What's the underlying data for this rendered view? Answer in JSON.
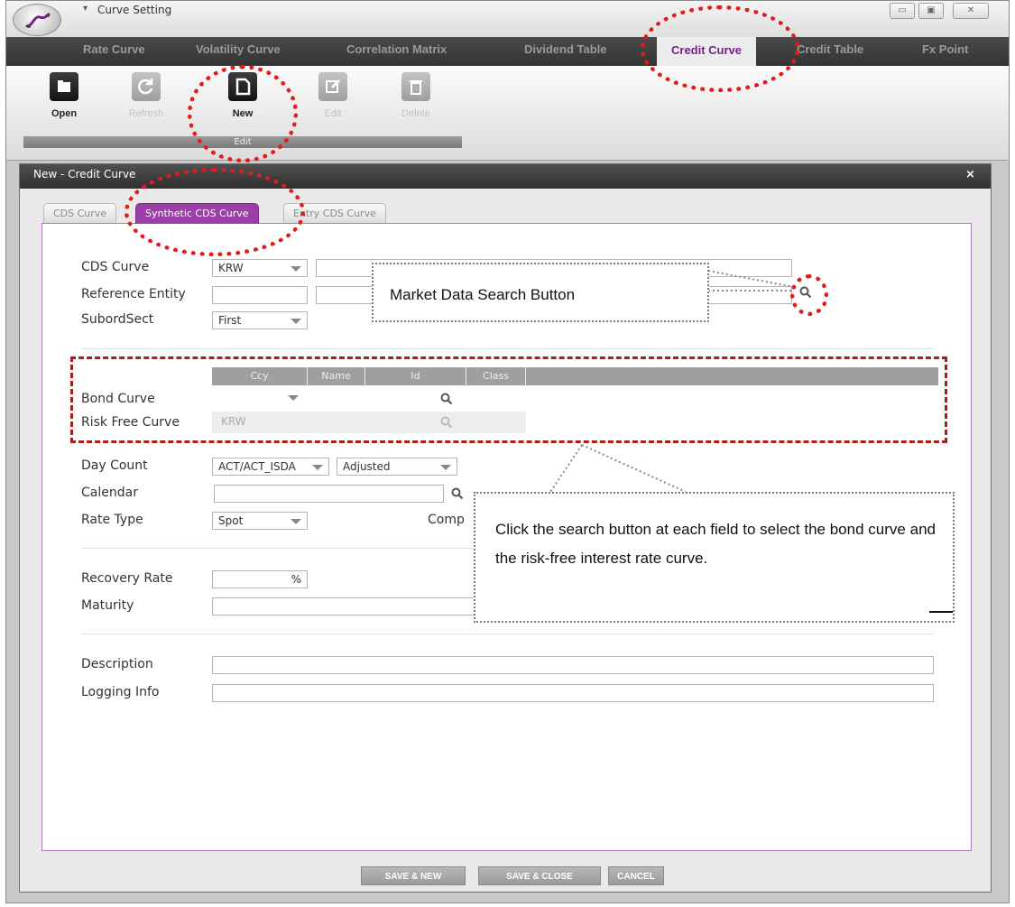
{
  "window": {
    "title": "Curve Setting",
    "controls": {
      "minimize": "▭",
      "maximize": "▣",
      "close": "✕"
    }
  },
  "ribbon_tabs": [
    {
      "label": "Rate Curve"
    },
    {
      "label": "Volatility Curve"
    },
    {
      "label": "Correlation Matrix"
    },
    {
      "label": "Dividend Table"
    },
    {
      "label": "Credit Curve"
    },
    {
      "label": "Credit Table"
    },
    {
      "label": "Fx Point"
    }
  ],
  "ribbon_buttons": [
    {
      "label": "Open",
      "icon": "folder-icon",
      "enabled": true
    },
    {
      "label": "Refresh",
      "icon": "refresh-icon",
      "enabled": false
    },
    {
      "label": "New",
      "icon": "new-document-icon",
      "enabled": true
    },
    {
      "label": "Edit",
      "icon": "edit-icon",
      "enabled": false
    },
    {
      "label": "Delete",
      "icon": "trash-icon",
      "enabled": false
    }
  ],
  "ribbon_group_label": "Edit",
  "dialog": {
    "title": "New - Credit Curve",
    "close": "×",
    "tabs": [
      {
        "label": "CDS Curve",
        "active": false
      },
      {
        "label": "Synthetic CDS Curve",
        "active": true
      },
      {
        "label": "Entry CDS Curve",
        "active": false
      }
    ]
  },
  "form": {
    "cds_curve_label": "CDS Curve",
    "cds_curve_ccy": "KRW",
    "reference_entity_label": "Reference Entity",
    "subordsect_label": "SubordSect",
    "subordsect_value": "First",
    "curve_table_headers": [
      "Ccy",
      "Name",
      "Id",
      "Class"
    ],
    "bond_curve_label": "Bond Curve",
    "risk_free_curve_label": "Risk Free Curve",
    "risk_free_ccy": "KRW",
    "day_count_label": "Day Count",
    "day_count_value": "ACT/ACT_ISDA",
    "day_count_adjust": "Adjusted",
    "calendar_label": "Calendar",
    "rate_type_label": "Rate Type",
    "rate_type_value": "Spot",
    "compounding_label_partial": "Comp",
    "recovery_rate_label": "Recovery Rate",
    "recovery_rate_unit": "%",
    "maturity_label": "Maturity",
    "description_label": "Description",
    "logging_info_label": "Logging Info"
  },
  "footer_buttons": [
    {
      "label": "SAVE & NEW"
    },
    {
      "label": "SAVE & CLOSE"
    },
    {
      "label": "CANCEL"
    }
  ],
  "annotations": {
    "market_data_search": "Market Data Search Button",
    "search_instruction": "Click the search button at each field to select the bond curve and the risk-free interest rate curve."
  },
  "colors": {
    "accent_purple": "#9b3fa7",
    "active_tab_text": "#7a1e8c",
    "highlight_red": "#e41b1b"
  }
}
